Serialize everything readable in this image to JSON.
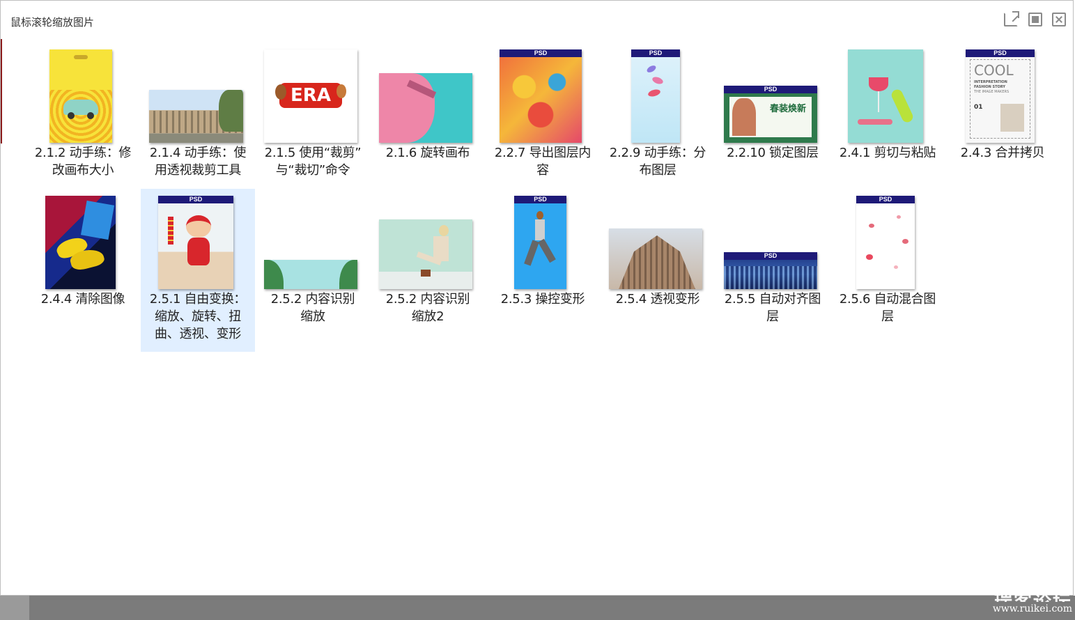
{
  "window": {
    "title": "鼠标滚轮缩放图片"
  },
  "badge": "PSD",
  "items": [
    {
      "label": "2.1.2 动手练：修改画布大小",
      "lines": [
        "2.1.2 动手练：修",
        "改画布大小"
      ],
      "icon": "image-thumbnail"
    },
    {
      "label": "2.1.4 动手练：使用透视裁剪工具",
      "lines": [
        "2.1.4 动手练：使",
        "用透视裁剪工具"
      ],
      "icon": "image-thumbnail"
    },
    {
      "label": "2.1.5 使用“裁剪”与“裁切”命令",
      "lines": [
        "2.1.5 使用“裁剪”",
        "与“裁切”命令"
      ],
      "icon": "image-thumbnail"
    },
    {
      "label": "2.1.6 旋转画布",
      "lines": [
        "2.1.6 旋转画布"
      ],
      "icon": "image-thumbnail"
    },
    {
      "label": "2.2.7 导出图层内容",
      "lines": [
        "2.2.7 导出图层内",
        "容"
      ],
      "icon": "psd-thumbnail"
    },
    {
      "label": "2.2.9 动手练：分布图层",
      "lines": [
        "2.2.9 动手练：分",
        "布图层"
      ],
      "icon": "psd-thumbnail"
    },
    {
      "label": "2.2.10 锁定图层",
      "lines": [
        "2.2.10 锁定图层"
      ],
      "icon": "psd-thumbnail"
    },
    {
      "label": "2.4.1 剪切与粘贴",
      "lines": [
        "2.4.1 剪切与粘贴"
      ],
      "icon": "image-thumbnail"
    },
    {
      "label": "2.4.3 合并拷贝",
      "lines": [
        "2.4.3 合并拷贝"
      ],
      "icon": "psd-thumbnail"
    },
    {
      "label": "2.4.4 清除图像",
      "lines": [
        "2.4.4 清除图像"
      ],
      "icon": "image-thumbnail"
    },
    {
      "label": "2.5.1 自由变换：缩放、旋转、扭曲、透视、变形",
      "lines": [
        "2.5.1 自由变换：",
        "缩放、旋转、扭",
        "曲、透视、变形"
      ],
      "icon": "psd-thumbnail",
      "selected": true
    },
    {
      "label": "2.5.2 内容识别缩放",
      "lines": [
        "2.5.2  内容识别",
        "缩放"
      ],
      "icon": "image-thumbnail"
    },
    {
      "label": "2.5.2 内容识别缩放2",
      "lines": [
        "2.5.2  内容识别",
        "缩放2"
      ],
      "icon": "image-thumbnail"
    },
    {
      "label": "2.5.3 操控变形",
      "lines": [
        "2.5.3  操控变形"
      ],
      "icon": "psd-thumbnail"
    },
    {
      "label": "2.5.4 透视变形",
      "lines": [
        "2.5.4 透视变形"
      ],
      "icon": "image-thumbnail"
    },
    {
      "label": "2.5.5 自动对齐图层",
      "lines": [
        "2.5.5 自动对齐图",
        "层"
      ],
      "icon": "psd-thumbnail"
    },
    {
      "label": "2.5.6 自动混合图层",
      "lines": [
        "2.5.6 自动混合图",
        "层"
      ],
      "icon": "psd-thumbnail"
    }
  ],
  "thumbnail_text": {
    "era": "ERA",
    "cool": "COOL",
    "cool_sub1": "INTERPRETATION",
    "cool_sub2": "FASHION STORY",
    "cool_sub3": "THE IMAGE MAKERS",
    "cool_num": "01",
    "spring": "春装焕新"
  },
  "watermark": {
    "text": "瑞客论坛",
    "url": "www.ruikei.com"
  },
  "colors": {
    "selection": "#e1efff",
    "psd_band": "#1e1a78",
    "taskbar": "#7b7b7b"
  }
}
